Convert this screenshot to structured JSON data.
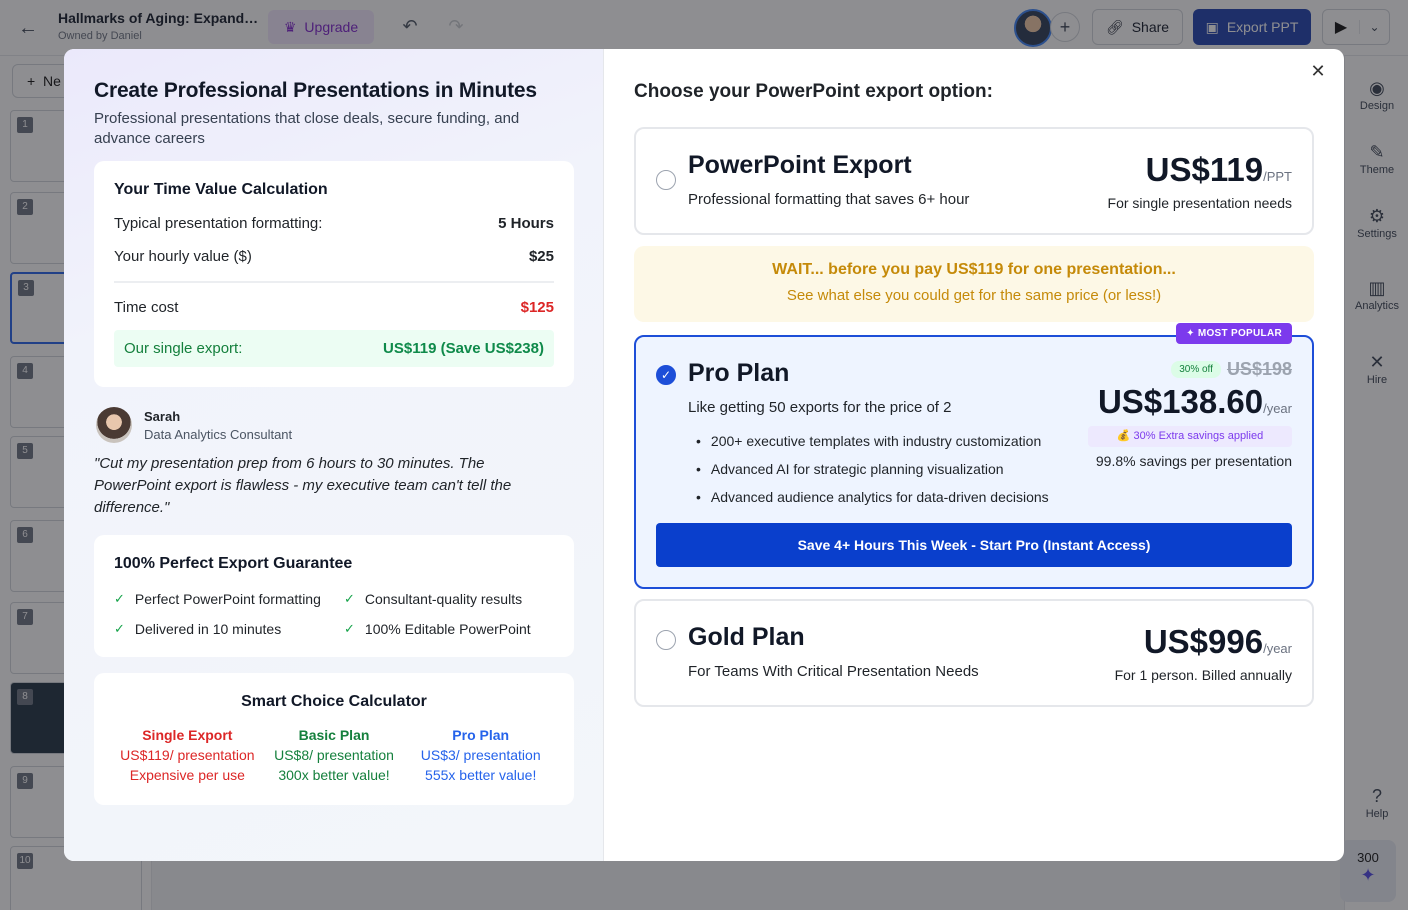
{
  "app": {
    "doc_title": "Hallmarks of Aging: Expand…",
    "owner": "Owned by Daniel",
    "upgrade_label": "Upgrade",
    "share_label": "Share",
    "export_label": "Export PPT",
    "new_label": "Ne",
    "slide_numbers": [
      "1",
      "2",
      "3",
      "4",
      "5",
      "6",
      "7",
      "8",
      "9",
      "10"
    ],
    "rail": [
      {
        "label": "Design",
        "icon": "palette-icon"
      },
      {
        "label": "Theme",
        "icon": "brush-icon"
      },
      {
        "label": "Settings",
        "icon": "gear-icon"
      },
      {
        "label": "Analytics",
        "icon": "chart-icon"
      },
      {
        "label": "Hire",
        "icon": "tools-icon"
      },
      {
        "label": "Help",
        "icon": "help-icon"
      }
    ],
    "credits": "300"
  },
  "left": {
    "title": "Create Professional Presentations in Minutes",
    "subtitle": "Professional presentations that close deals, secure funding, and advance careers",
    "calc": {
      "heading": "Your Time Value Calculation",
      "row1_label": "Typical presentation formatting:",
      "row1_value": "5 Hours",
      "row2_label": "Your hourly value ($)",
      "row2_value": "$25",
      "cost_label": "Time cost",
      "cost_value": "$125",
      "export_label": "Our single export:",
      "export_value": "US$119 (Save US$238)"
    },
    "testimonial": {
      "name": "Sarah",
      "role": "Data Analytics Consultant",
      "quote": "\"Cut my presentation prep from 6 hours to 30 minutes. The PowerPoint export is flawless - my executive team can't tell the difference.\""
    },
    "guarantee": {
      "heading": "100% Perfect Export Guarantee",
      "items": [
        "Perfect PowerPoint formatting",
        "Consultant-quality results",
        "Delivered in 10 minutes",
        "100% Editable PowerPoint"
      ]
    },
    "smart": {
      "heading": "Smart Choice Calculator",
      "single": {
        "title": "Single Export",
        "price": "US$119/ presentation",
        "note": "Expensive per use"
      },
      "basic": {
        "title": "Basic Plan",
        "price": "US$8/ presentation",
        "note": "300x better value!"
      },
      "pro": {
        "title": "Pro Plan",
        "price": "US$3/ presentation",
        "note": "555x better value!"
      }
    }
  },
  "right": {
    "title": "Choose your PowerPoint export option:",
    "ppt": {
      "name": "PowerPoint Export",
      "desc": "Professional formatting that saves 6+ hour",
      "price": "US$119",
      "unit": "/PPT",
      "note": "For single presentation needs",
      "selected": false
    },
    "wait": {
      "title": "WAIT... before you pay US$119 for one presentation...",
      "sub": "See what else you could get for the same price (or less!)"
    },
    "pro": {
      "badge": "MOST POPULAR",
      "name": "Pro Plan",
      "desc": "Like getting 50 exports for the price of 2",
      "off_badge": "30% off",
      "old_price": "US$198",
      "price": "US$138.60",
      "unit": "/year",
      "extra": "💰 30% Extra savings applied",
      "savings": "99.8% savings per presentation",
      "features": [
        "200+ executive templates with industry customization",
        "Advanced AI for strategic planning visualization",
        "Advanced audience analytics for data-driven decisions"
      ],
      "cta": "Save 4+ Hours This Week - Start Pro (Instant Access)",
      "selected": true
    },
    "gold": {
      "name": "Gold Plan",
      "desc": "For Teams With Critical Presentation Needs",
      "price": "US$996",
      "unit": "/year",
      "note": "For 1 person. Billed annually",
      "selected": false
    }
  },
  "colors": {
    "accent": "#1d4ed8",
    "cta": "#0a3fcc",
    "popular": "#7c3aed",
    "danger": "#dc2626",
    "success": "#15803d",
    "warning": "#c58a09"
  }
}
